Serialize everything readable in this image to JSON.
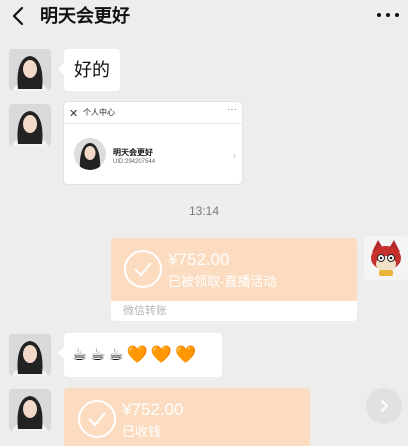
{
  "header": {
    "title": "明天会更好",
    "back_icon": "chevron-left-icon",
    "more_icon": "more-dots-icon"
  },
  "messages": {
    "text1": "好的",
    "card": {
      "close": "✕",
      "title": "个人中心",
      "more": "···",
      "name": "明天会更好",
      "uid": "UID:294207544"
    },
    "timestamp": "13:14",
    "transfer1": {
      "amount": "¥752.00",
      "status": "已被领取-直播活动",
      "footer": "微信转账"
    },
    "emoji": [
      "☕",
      "☕",
      "☕",
      "🧡",
      "🧡",
      "🧡"
    ],
    "transfer2": {
      "amount": "¥752.00",
      "status": "已收钱"
    }
  },
  "colors": {
    "background": "#ededed",
    "transfer_card": "#fbdcc0",
    "bubble": "#ffffff"
  }
}
